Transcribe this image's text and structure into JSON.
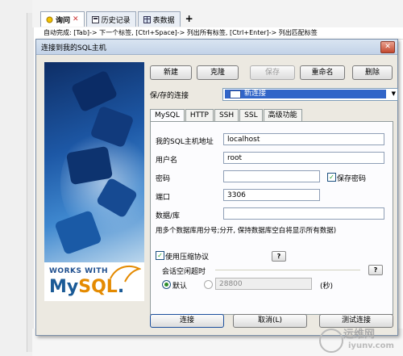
{
  "app": {
    "tabs": [
      {
        "label": "询问",
        "active": true
      },
      {
        "label": "历史记录",
        "active": false
      },
      {
        "label": "表数据",
        "active": false
      }
    ],
    "add_tab": "+",
    "autocomplete_hint": "自动完成: [Tab]-> 下一个标签, [Ctrl+Space]-> 列出所有标签, [Ctrl+Enter]-> 列出匹配标签"
  },
  "dialog": {
    "title": "连接到我的SQL主机",
    "close_glyph": "✕",
    "banner": {
      "works_with": "WORKS WITH",
      "logo_my": "My",
      "logo_sql": "SQL",
      "logo_dot": "."
    },
    "toolbar": {
      "new": "新建",
      "clone": "克隆",
      "save": "保存",
      "rename": "重命名",
      "delete": "删除"
    },
    "saved_conn_label": "保/存的连接",
    "saved_conn_value": "新连接",
    "tabs": [
      "MySQL",
      "HTTP",
      "SSH",
      "SSL",
      "高级功能"
    ],
    "fields": {
      "host_label": "我的SQL主机地址",
      "host_value": "localhost",
      "user_label": "用户名",
      "user_value": "root",
      "password_label": "密码",
      "password_value": "",
      "save_password_label": "保存密码",
      "port_label": "端口",
      "port_value": "3306",
      "db_label": "数据/库",
      "db_value": "",
      "db_hint": "用多个数据库用分号;分开, 保持数据库空白将显示所有数据)",
      "compression_label": "使用压缩协议",
      "timeout_label": "会话空闲超时",
      "default_label": "默认",
      "timeout_value": "28800",
      "seconds_label": "(秒)",
      "help": "?"
    },
    "footer": {
      "connect": "连接",
      "cancel": "取消(L)",
      "test": "测试连接"
    }
  },
  "watermark": {
    "line1": "运维网",
    "line2": "iyunv.com"
  }
}
